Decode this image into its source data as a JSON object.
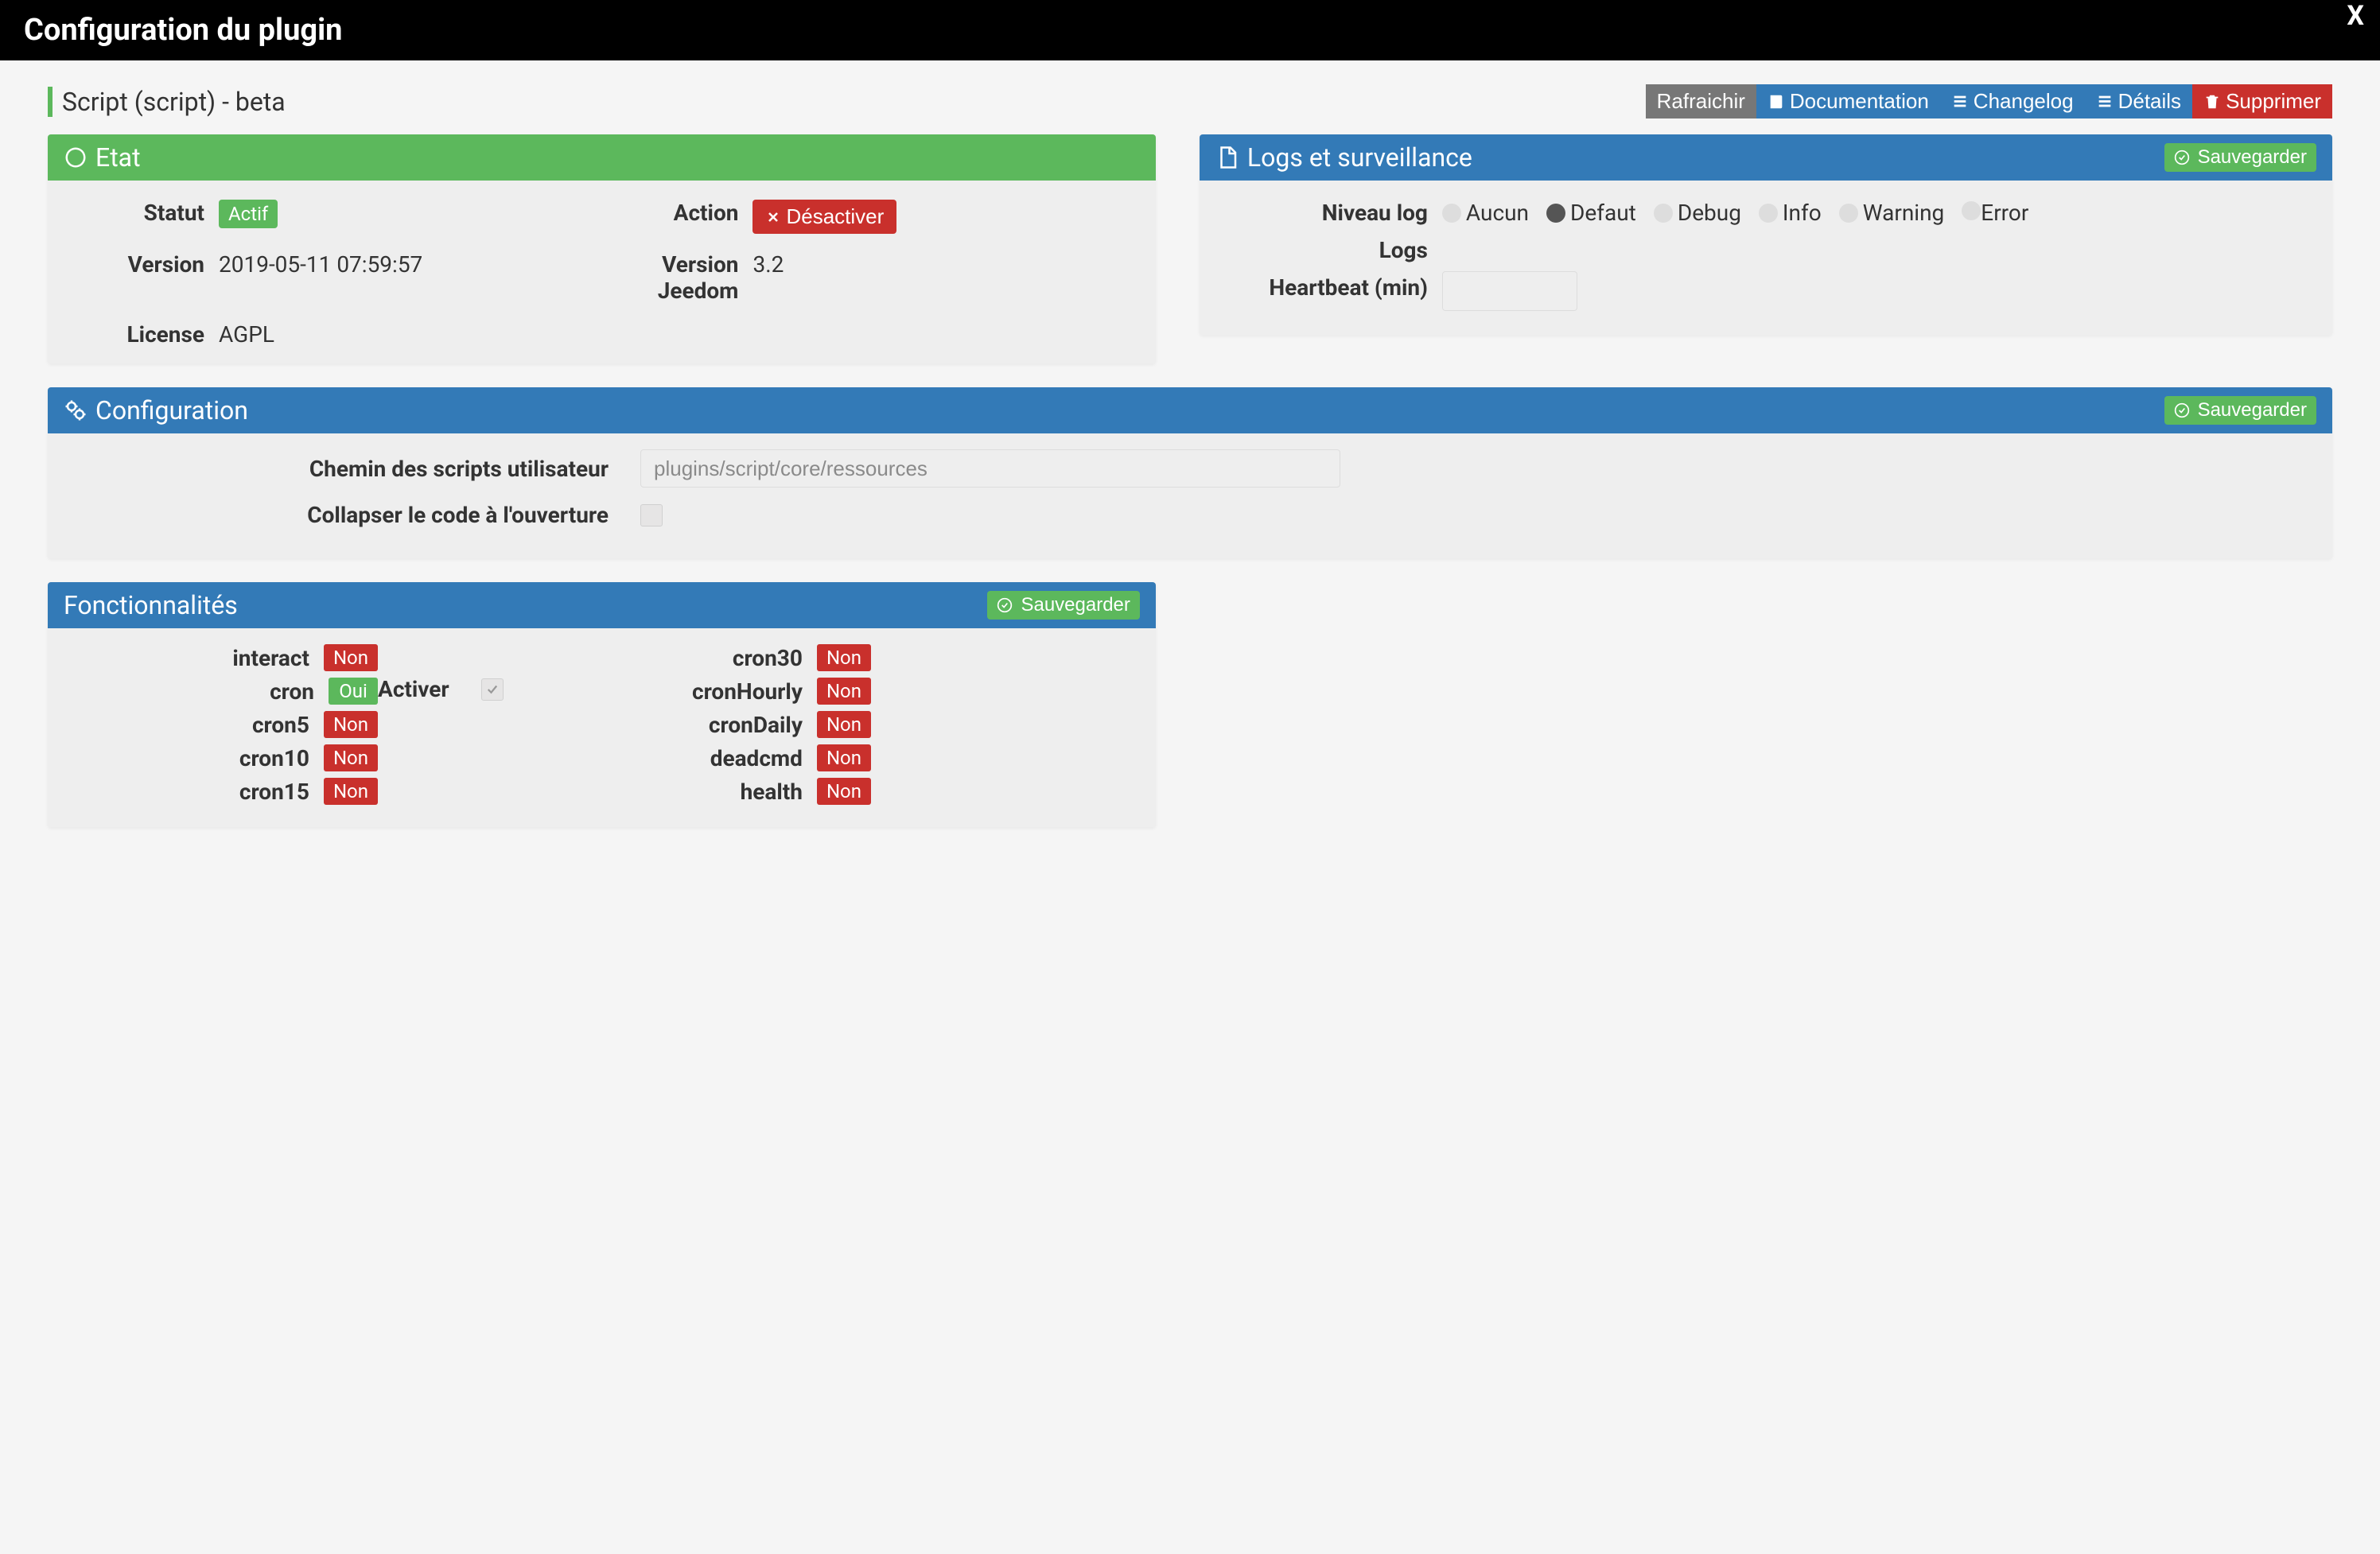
{
  "dialog": {
    "title": "Configuration du plugin",
    "close": "X"
  },
  "pluginTitle": "Script (script) - beta",
  "topButtons": {
    "refresh": "Rafraichir",
    "documentation": "Documentation",
    "changelog": "Changelog",
    "details": "Détails",
    "delete": "Supprimer"
  },
  "etat": {
    "heading": "Etat",
    "statusLabel": "Statut",
    "statusBadge": "Actif",
    "actionLabel": "Action",
    "deactivate": "Désactiver",
    "versionLabel": "Version",
    "versionValue": "2019-05-11 07:59:57",
    "jeedomVersionLabel": "Version Jeedom",
    "jeedomVersionValue": "3.2",
    "licenseLabel": "License",
    "licenseValue": "AGPL"
  },
  "logs": {
    "heading": "Logs et surveillance",
    "save": "Sauvegarder",
    "levelLabel": "Niveau log",
    "levels": {
      "none": "Aucun",
      "default": "Defaut",
      "debug": "Debug",
      "info": "Info",
      "warning": "Warning",
      "error": "Error"
    },
    "selected": "default",
    "logsLabel": "Logs",
    "heartbeatLabel": "Heartbeat (min)",
    "heartbeatValue": ""
  },
  "config": {
    "heading": "Configuration",
    "save": "Sauvegarder",
    "scriptPathLabel": "Chemin des scripts utilisateur",
    "scriptPathValue": "plugins/script/core/ressources",
    "collapseLabel": "Collapser le code à l'ouverture",
    "collapseChecked": false
  },
  "func": {
    "heading": "Fonctionnalités",
    "save": "Sauvegarder",
    "activateLabel": "Activer",
    "activateChecked": true,
    "yes": "Oui",
    "no": "Non",
    "left": [
      {
        "name": "interact",
        "on": false
      },
      {
        "name": "cron",
        "on": true
      },
      {
        "name": "cron5",
        "on": false
      },
      {
        "name": "cron10",
        "on": false
      },
      {
        "name": "cron15",
        "on": false
      }
    ],
    "right": [
      {
        "name": "cron30",
        "on": false
      },
      {
        "name": "cronHourly",
        "on": false
      },
      {
        "name": "cronDaily",
        "on": false
      },
      {
        "name": "deadcmd",
        "on": false
      },
      {
        "name": "health",
        "on": false
      }
    ]
  }
}
